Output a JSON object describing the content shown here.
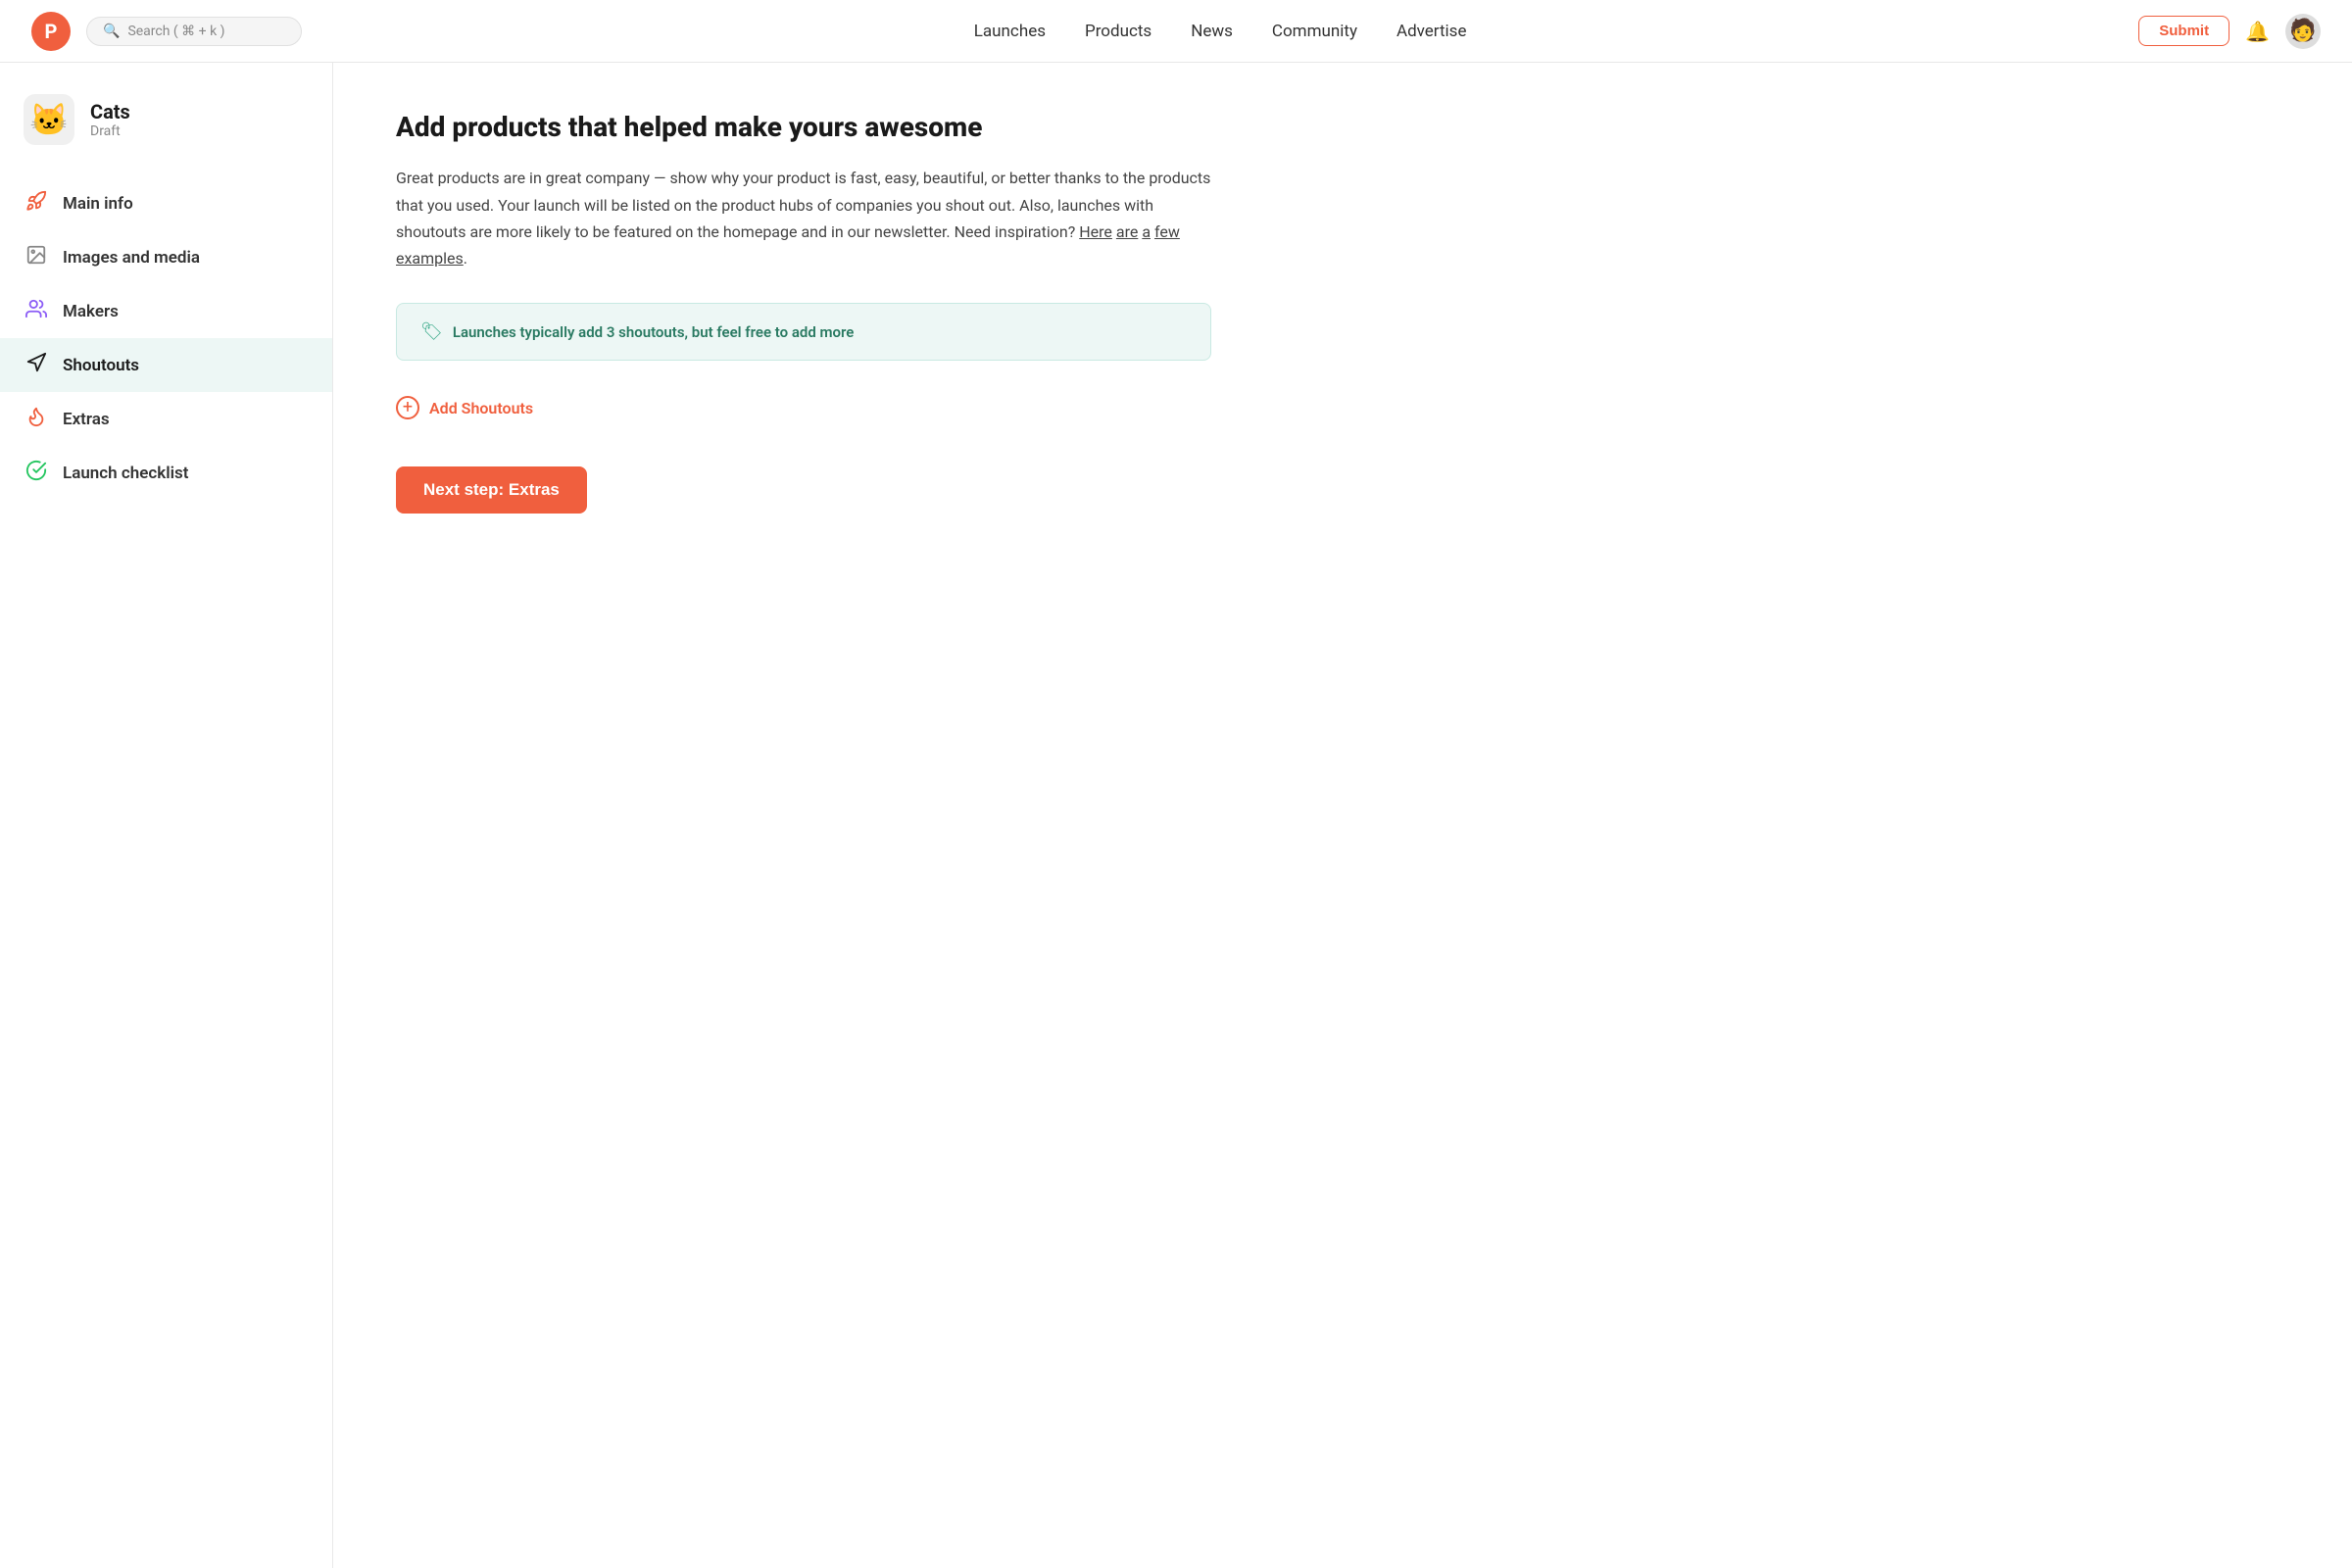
{
  "header": {
    "logo_letter": "P",
    "search_placeholder": "Search ( ⌘ + k )",
    "nav_items": [
      {
        "label": "Launches",
        "id": "launches"
      },
      {
        "label": "Products",
        "id": "products"
      },
      {
        "label": "News",
        "id": "news"
      },
      {
        "label": "Community",
        "id": "community"
      },
      {
        "label": "Advertise",
        "id": "advertise"
      }
    ],
    "submit_label": "Submit",
    "avatar_emoji": "🧑"
  },
  "sidebar": {
    "product_name": "Cats",
    "product_status": "Draft",
    "product_icon": "🐱",
    "nav_items": [
      {
        "id": "main-info",
        "label": "Main info",
        "icon": "rocket"
      },
      {
        "id": "images-media",
        "label": "Images and media",
        "icon": "image"
      },
      {
        "id": "makers",
        "label": "Makers",
        "icon": "people"
      },
      {
        "id": "shoutouts",
        "label": "Shoutouts",
        "icon": "megaphone",
        "active": true
      },
      {
        "id": "extras",
        "label": "Extras",
        "icon": "fire"
      },
      {
        "id": "launch-checklist",
        "label": "Launch checklist",
        "icon": "check-circle"
      }
    ]
  },
  "main": {
    "title": "Add products that helped make yours awesome",
    "description": "Great products are in great company — show why your product is fast, easy, beautiful, or better thanks to the products that you used. Your launch will be listed on the product hubs of companies you shout out. Also, launches with shoutouts are more likely to be featured on the homepage and in our newsletter. Need inspiration?",
    "desc_links": [
      "Here",
      "are",
      "a",
      "few",
      "examples"
    ],
    "info_box_text": "🏷 Launches typically add 3 shoutouts, but feel free to add more",
    "add_shoutouts_label": "Add Shoutouts",
    "next_step_label": "Next step: Extras"
  },
  "colors": {
    "accent": "#f05f3e",
    "active_bg": "#edf7f5",
    "info_bg": "#edf7f5",
    "info_border": "#c8e9e2",
    "info_text": "#2a7a62"
  }
}
